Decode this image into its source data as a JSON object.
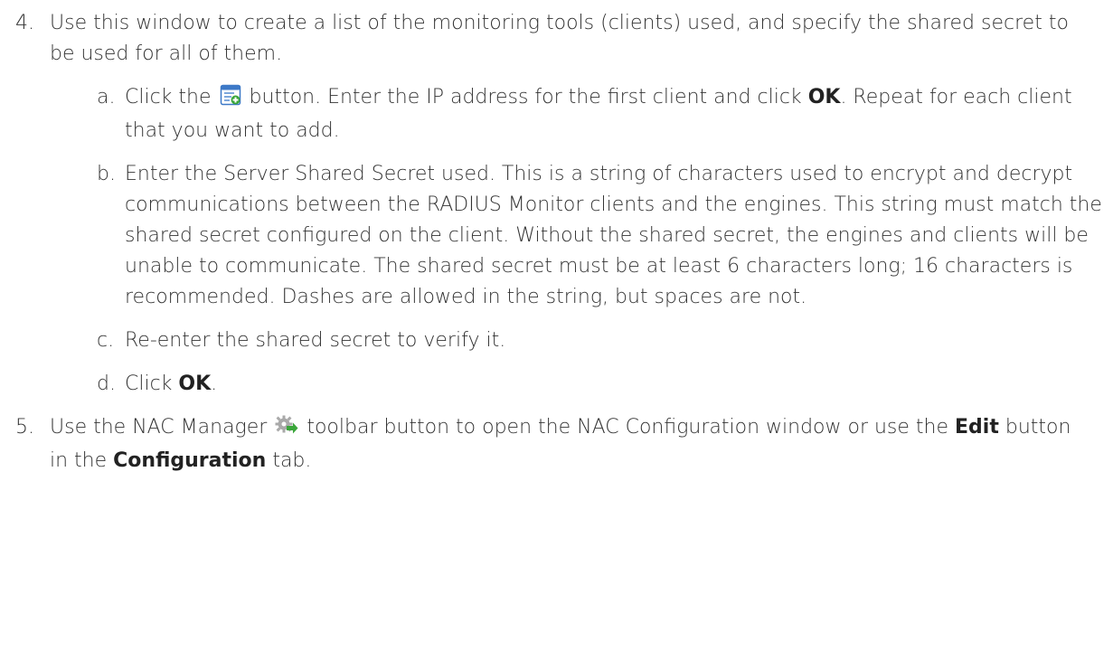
{
  "step4": {
    "number": "4.",
    "text": "Use this window to create a list of the monitoring tools (clients) used, and specify the shared secret to be used for all of them.",
    "sub_a": {
      "letter": "a.",
      "pre": "Click the",
      "icon": "add-client-icon",
      "mid": "button. Enter the IP address for the first client and click",
      "ok": "OK",
      "post": ". Repeat for each client that you want to add."
    },
    "sub_b": {
      "letter": "b.",
      "text": "Enter the Server Shared Secret used. This is a string of characters used to encrypt and decrypt communications between the RADIUS Monitor clients and the engines. This string must match the shared secret configured on the client. Without the shared secret, the engines and clients will be unable to communicate. The shared secret must be at least 6 characters long; 16 characters is recommended. Dashes are allowed in the string, but spaces are not."
    },
    "sub_c": {
      "letter": "c.",
      "text": "Re-enter the shared secret to verify it."
    },
    "sub_d": {
      "letter": "d.",
      "pre": "Click",
      "ok": "OK",
      "post": "."
    }
  },
  "step5": {
    "number": "5.",
    "pre": "Use the NAC Manager",
    "icon": "nac-manager-gear-icon",
    "mid": "toolbar button to open the NAC Configuration window or use the",
    "edit": "Edit",
    "mid2": "button in the",
    "configuration": "Configuration",
    "post": "tab."
  },
  "colors": {
    "text": "#333333",
    "icon_blue": "#3d79c7",
    "icon_green": "#3aa63a",
    "gear_gray": "#a9a9a9"
  }
}
